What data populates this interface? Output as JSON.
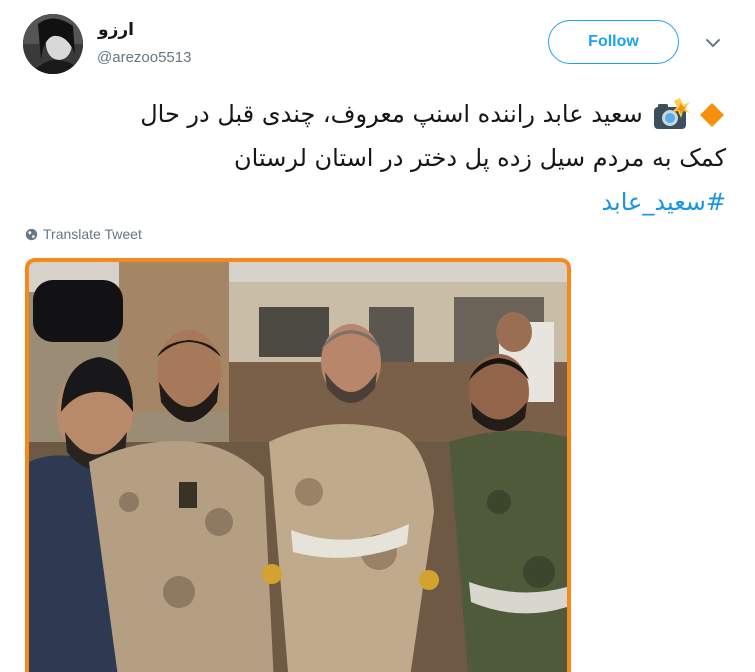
{
  "user": {
    "display_name": "ارزو",
    "handle": "@arezoo5513"
  },
  "actions": {
    "follow_label": "Follow"
  },
  "tweet": {
    "line1": "سعید عابد راننده اسنپ معروف، چندی قبل در حال",
    "line2": "کمک به مردم سیل زده پل دختر در استان لرستان",
    "hashtag": "#سعید_عابد",
    "translate_label": "Translate Tweet"
  },
  "icons": {
    "bullet": "orange-diamond-icon",
    "camera": "camera-flash-icon",
    "caret": "chevron-down-icon",
    "globe": "globe-icon"
  },
  "colors": {
    "accent": "#1da1f2",
    "hashtag": "#1b95e0",
    "photo_border": "#f48a1e",
    "muted": "#657786"
  }
}
